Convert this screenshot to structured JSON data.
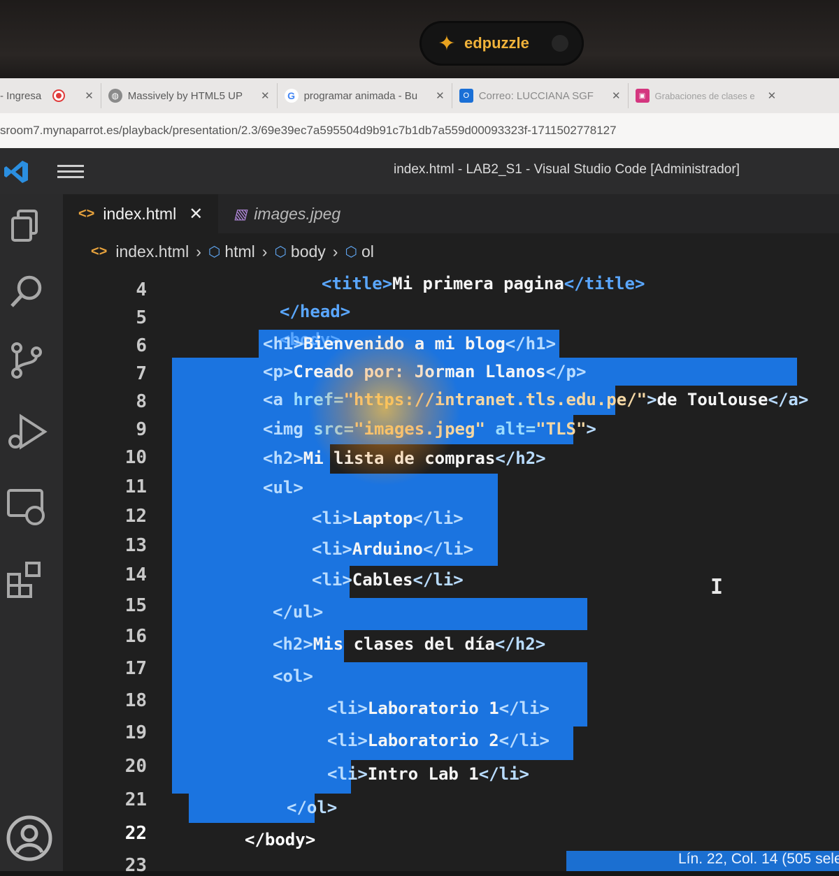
{
  "device_overlay": {
    "app_badge": "edpuzzle"
  },
  "browser": {
    "tabs": [
      {
        "label": "- Ingresa",
        "icon": "record-icon"
      },
      {
        "label": "Massively by HTML5 UP",
        "icon": "globe-icon"
      },
      {
        "label": "programar animada - Bu",
        "icon": "google-icon"
      },
      {
        "label": "Correo: LUCCIANA SGF",
        "icon": "outlook-icon"
      },
      {
        "label": "Grabaciones de clases e",
        "icon": "recordings-icon"
      }
    ],
    "url": "sroom7.mynaparrot.es/playback/presentation/2.3/69e39ec7a595504d9b91c7b1db7a559d00093323f-1711502778127"
  },
  "vscode": {
    "window_title": "index.html - LAB2_S1 - Visual Studio Code [Administrador]",
    "editor_tabs": [
      {
        "label": "index.html",
        "active": true
      },
      {
        "label": "images.jpeg",
        "active": false
      }
    ],
    "breadcrumb": [
      "index.html",
      "html",
      "body",
      "ol"
    ],
    "line_numbers": [
      "4",
      "5",
      "6",
      "7",
      "8",
      "9",
      "10",
      "11",
      "12",
      "13",
      "14",
      "15",
      "16",
      "17",
      "18",
      "19",
      "20",
      "21",
      "22",
      "23"
    ],
    "current_line": "22",
    "code": {
      "l4": {
        "open": "<title>",
        "text": "Mi primera pagina",
        "close": "</title>"
      },
      "l5": "</head>",
      "l6": "<body>",
      "l7": {
        "open": "<h1>",
        "text": "Bienvenido a mi blog",
        "close": "</h1>"
      },
      "l8": {
        "open": "<p>",
        "text": "Creado por: Jorman Llanos",
        "close": "</p>"
      },
      "l9": {
        "open": "<a",
        "attr": " href=",
        "value": "\"https://intranet.tls.edu.pe/\"",
        "gt": ">",
        "text": "de Toulouse",
        "close": "</a>"
      },
      "l10": {
        "open": "<img",
        "attr1": " src=",
        "value1": "\"images.jpeg\"",
        "attr2": " alt=",
        "value2": "\"TLS\"",
        "gt": ">"
      },
      "l11": {
        "open": "<h2>",
        "text": "Mi lista de compras",
        "close": "</h2>"
      },
      "l12": "<ul>",
      "l13": {
        "open": "<li>",
        "text": "Laptop",
        "close": "</li>"
      },
      "l14": {
        "open": "<li>",
        "text": "Arduino",
        "close": "</li>"
      },
      "l15": {
        "open": "<li>",
        "text": "Cables",
        "close": "</li>"
      },
      "l16": "</ul>",
      "l17": {
        "open": "<h2>",
        "text": "Mis clases del día",
        "close": "</h2>"
      },
      "l18": "<ol>",
      "l19": {
        "open": "<li>",
        "text": "Laboratorio 1",
        "close": "</li>"
      },
      "l20": {
        "open": "<li>",
        "text": "Laboratorio 2",
        "close": "</li>"
      },
      "l21": {
        "open": "<li>",
        "text": "Intro Lab 1",
        "close": "</li>"
      },
      "l22": "</ol>",
      "l23": "</body>"
    },
    "status": "Lín. 22, Col. 14 (505 sele"
  },
  "colors": {
    "selection": "#1b74e0",
    "tag": "#5aa7ff",
    "activity_bar": "#2b2b2c",
    "editor_bg": "#1f1f1f"
  }
}
